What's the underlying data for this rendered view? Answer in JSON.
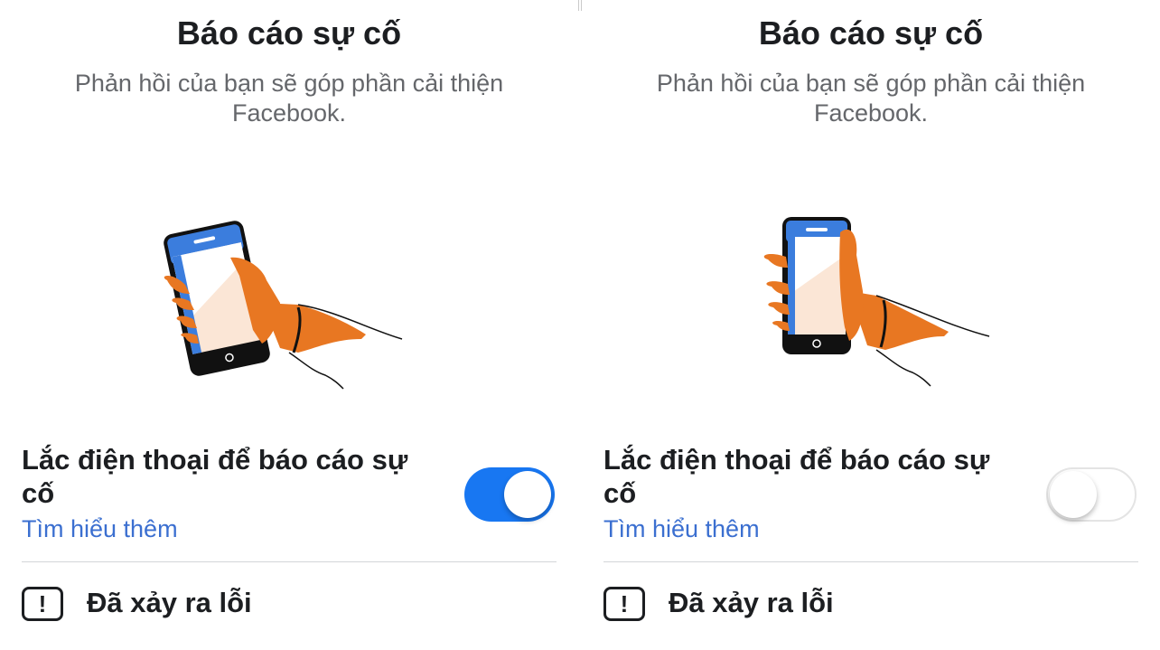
{
  "panels": [
    {
      "title": "Báo cáo sự cố",
      "subtitle": "Phản hồi của bạn sẽ góp phần cải thiện Facebook.",
      "setting_label": "Lắc điện thoại để báo cáo sự cố",
      "learn_more": "Tìm hiểu thêm",
      "toggle_state": "on",
      "error_icon_glyph": "!",
      "error_text": "Đã xảy ra lỗi"
    },
    {
      "title": "Báo cáo sự cố",
      "subtitle": "Phản hồi của bạn sẽ góp phần cải thiện Facebook.",
      "setting_label": "Lắc điện thoại để báo cáo sự cố",
      "learn_more": "Tìm hiểu thêm",
      "toggle_state": "off",
      "error_icon_glyph": "!",
      "error_text": "Đã xảy ra lỗi"
    }
  ],
  "colors": {
    "toggle_on": "#1877f2",
    "link": "#3b6fd0",
    "hand": "#e87722",
    "phone_blue": "#3b7ddd"
  },
  "icons": [
    "phone-shake-illustration",
    "error-icon"
  ]
}
